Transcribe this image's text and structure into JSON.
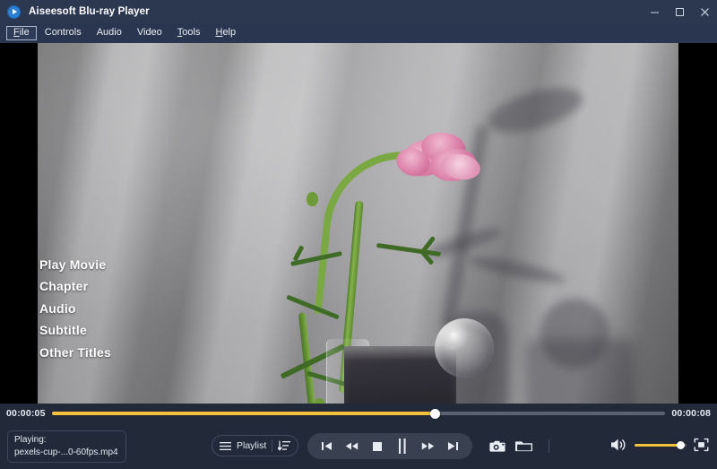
{
  "window": {
    "title": "Aiseesoft Blu-ray Player",
    "app_icon": "play-circle-icon",
    "controls": {
      "minimize": "minimize-icon",
      "maximize": "maximize-icon",
      "close": "close-icon"
    }
  },
  "menubar": {
    "items": [
      {
        "label": "File",
        "mnemonic": "F",
        "focused": true
      },
      {
        "label": "Controls",
        "mnemonic": "C",
        "focused": false
      },
      {
        "label": "Audio",
        "mnemonic": "A",
        "focused": false
      },
      {
        "label": "Video",
        "mnemonic": "V",
        "focused": false
      },
      {
        "label": "Tools",
        "mnemonic": "T",
        "focused": false
      },
      {
        "label": "Help",
        "mnemonic": "H",
        "focused": false
      }
    ]
  },
  "video": {
    "description": "Pink ranunculus flower in a glass vase on a dark stone block with a glass sphere, lit by striped window shadows on a gray wall",
    "disc_menu": {
      "items": [
        "Play Movie",
        "Chapter",
        "Audio",
        "Subtitle",
        "Other Titles"
      ]
    }
  },
  "seek": {
    "current_time": "00:00:05",
    "total_time": "00:00:08",
    "progress_percent": 62.5
  },
  "now_playing": {
    "status_label": "Playing:",
    "file_name": "pexels-cup-...0-60fps.mp4"
  },
  "playlist": {
    "label": "Playlist",
    "list_icon": "hamburger-list-icon",
    "sort_icon": "sort-descending-icon"
  },
  "transport": {
    "buttons": [
      {
        "name": "previous-button",
        "icon": "skip-previous-icon"
      },
      {
        "name": "rewind-button",
        "icon": "rewind-icon"
      },
      {
        "name": "stop-button",
        "icon": "stop-icon"
      },
      {
        "name": "pause-button",
        "icon": "pause-icon"
      },
      {
        "name": "fast-forward-button",
        "icon": "fast-forward-icon"
      },
      {
        "name": "next-button",
        "icon": "skip-next-icon"
      }
    ]
  },
  "utilities": {
    "snapshot_icon": "camera-icon",
    "open-file_icon": "folder-icon"
  },
  "volume": {
    "icon": "speaker-on-icon",
    "level_percent": 88
  },
  "fullscreen": {
    "icon": "fullscreen-icon"
  },
  "colors": {
    "titlebar": "#2c3850",
    "menubar": "#2a3650",
    "chrome": "#222a3a",
    "accent": "#f5c13d",
    "text": "#e8ecf3",
    "transport_pill": "#39404f"
  }
}
